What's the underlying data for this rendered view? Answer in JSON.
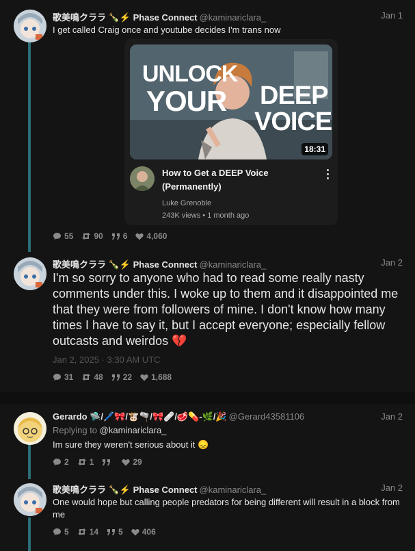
{
  "tweets": [
    {
      "name": "歌美鳴クララ 🍾⚡ Phase Connect",
      "handle": "@kaminariclara_",
      "date": "Jan 1",
      "text": "I get called Craig once and youtube decides I'm trans now",
      "stats": {
        "replies": "55",
        "retweets": "90",
        "quotes": "6",
        "likes": "4,060"
      }
    },
    {
      "name": "歌美鳴クララ 🍾⚡ Phase Connect",
      "handle": "@kaminariclara_",
      "date": "Jan 2",
      "text": "I'm so sorry to anyone who had to read some really nasty comments under this. I woke up to them and it disappointed me that they were from followers of mine. I don't know how many times I have to say it, but I accept everyone; especially fellow outcasts and weirdos 💔",
      "timestamp": "Jan 2, 2025 · 3:30 AM UTC",
      "stats": {
        "replies": "31",
        "retweets": "48",
        "quotes": "22",
        "likes": "1,688"
      }
    },
    {
      "name": "Gerardo 🛸/🖊️🎀/🐮🫗/🎀🩹/🥩💊-🌿/🎉",
      "handle": "@Gerard43581106",
      "date": "Jan 2",
      "replying_label": "Replying to",
      "replying_to": "@kaminariclara_",
      "text": "Im sure they weren't serious about it 😞",
      "stats": {
        "replies": "2",
        "retweets": "1",
        "quotes": "",
        "likes": "29"
      }
    },
    {
      "name": "歌美鳴クララ 🍾⚡ Phase Connect",
      "handle": "@kaminariclara_",
      "date": "Jan 2",
      "text": "One would hope but calling people predators for being different will result in a block from me",
      "stats": {
        "replies": "5",
        "retweets": "14",
        "quotes": "5",
        "likes": "406"
      }
    }
  ],
  "video": {
    "thumb_line1": "UNLOCK",
    "thumb_line2": "YOUR",
    "thumb_line3": "DEEP",
    "thumb_line4": "VOICE",
    "duration": "18:31",
    "title": "How to Get a DEEP Voice (Permanently)",
    "channel": "Luke Grenoble",
    "meta": "243K views • 1 month ago"
  },
  "colors": {
    "background": "#0f0f0f",
    "thread_line": "#2b6c75",
    "muted": "#8a8a8a"
  }
}
